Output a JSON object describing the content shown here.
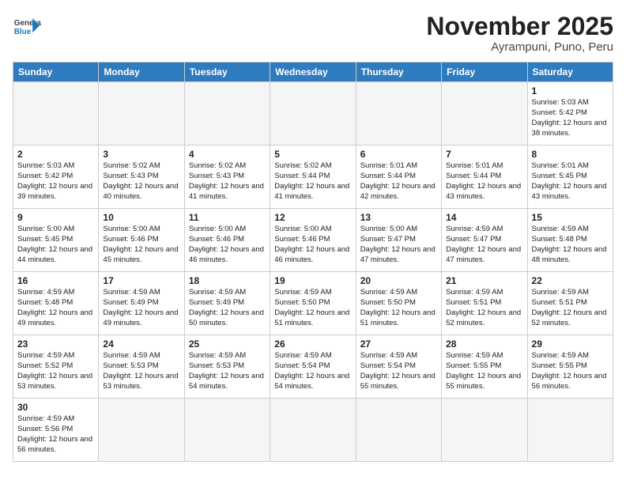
{
  "header": {
    "logo_general": "General",
    "logo_blue": "Blue",
    "month_title": "November 2025",
    "location": "Ayrampuni, Puno, Peru"
  },
  "weekdays": [
    "Sunday",
    "Monday",
    "Tuesday",
    "Wednesday",
    "Thursday",
    "Friday",
    "Saturday"
  ],
  "cells": [
    [
      {
        "day": "",
        "info": ""
      },
      {
        "day": "",
        "info": ""
      },
      {
        "day": "",
        "info": ""
      },
      {
        "day": "",
        "info": ""
      },
      {
        "day": "",
        "info": ""
      },
      {
        "day": "",
        "info": ""
      },
      {
        "day": "1",
        "info": "Sunrise: 5:03 AM\nSunset: 5:42 PM\nDaylight: 12 hours and 38 minutes."
      }
    ],
    [
      {
        "day": "2",
        "info": "Sunrise: 5:03 AM\nSunset: 5:42 PM\nDaylight: 12 hours and 39 minutes."
      },
      {
        "day": "3",
        "info": "Sunrise: 5:02 AM\nSunset: 5:43 PM\nDaylight: 12 hours and 40 minutes."
      },
      {
        "day": "4",
        "info": "Sunrise: 5:02 AM\nSunset: 5:43 PM\nDaylight: 12 hours and 41 minutes."
      },
      {
        "day": "5",
        "info": "Sunrise: 5:02 AM\nSunset: 5:44 PM\nDaylight: 12 hours and 41 minutes."
      },
      {
        "day": "6",
        "info": "Sunrise: 5:01 AM\nSunset: 5:44 PM\nDaylight: 12 hours and 42 minutes."
      },
      {
        "day": "7",
        "info": "Sunrise: 5:01 AM\nSunset: 5:44 PM\nDaylight: 12 hours and 43 minutes."
      },
      {
        "day": "8",
        "info": "Sunrise: 5:01 AM\nSunset: 5:45 PM\nDaylight: 12 hours and 43 minutes."
      }
    ],
    [
      {
        "day": "9",
        "info": "Sunrise: 5:00 AM\nSunset: 5:45 PM\nDaylight: 12 hours and 44 minutes."
      },
      {
        "day": "10",
        "info": "Sunrise: 5:00 AM\nSunset: 5:46 PM\nDaylight: 12 hours and 45 minutes."
      },
      {
        "day": "11",
        "info": "Sunrise: 5:00 AM\nSunset: 5:46 PM\nDaylight: 12 hours and 46 minutes."
      },
      {
        "day": "12",
        "info": "Sunrise: 5:00 AM\nSunset: 5:46 PM\nDaylight: 12 hours and 46 minutes."
      },
      {
        "day": "13",
        "info": "Sunrise: 5:00 AM\nSunset: 5:47 PM\nDaylight: 12 hours and 47 minutes."
      },
      {
        "day": "14",
        "info": "Sunrise: 4:59 AM\nSunset: 5:47 PM\nDaylight: 12 hours and 47 minutes."
      },
      {
        "day": "15",
        "info": "Sunrise: 4:59 AM\nSunset: 5:48 PM\nDaylight: 12 hours and 48 minutes."
      }
    ],
    [
      {
        "day": "16",
        "info": "Sunrise: 4:59 AM\nSunset: 5:48 PM\nDaylight: 12 hours and 49 minutes."
      },
      {
        "day": "17",
        "info": "Sunrise: 4:59 AM\nSunset: 5:49 PM\nDaylight: 12 hours and 49 minutes."
      },
      {
        "day": "18",
        "info": "Sunrise: 4:59 AM\nSunset: 5:49 PM\nDaylight: 12 hours and 50 minutes."
      },
      {
        "day": "19",
        "info": "Sunrise: 4:59 AM\nSunset: 5:50 PM\nDaylight: 12 hours and 51 minutes."
      },
      {
        "day": "20",
        "info": "Sunrise: 4:59 AM\nSunset: 5:50 PM\nDaylight: 12 hours and 51 minutes."
      },
      {
        "day": "21",
        "info": "Sunrise: 4:59 AM\nSunset: 5:51 PM\nDaylight: 12 hours and 52 minutes."
      },
      {
        "day": "22",
        "info": "Sunrise: 4:59 AM\nSunset: 5:51 PM\nDaylight: 12 hours and 52 minutes."
      }
    ],
    [
      {
        "day": "23",
        "info": "Sunrise: 4:59 AM\nSunset: 5:52 PM\nDaylight: 12 hours and 53 minutes."
      },
      {
        "day": "24",
        "info": "Sunrise: 4:59 AM\nSunset: 5:53 PM\nDaylight: 12 hours and 53 minutes."
      },
      {
        "day": "25",
        "info": "Sunrise: 4:59 AM\nSunset: 5:53 PM\nDaylight: 12 hours and 54 minutes."
      },
      {
        "day": "26",
        "info": "Sunrise: 4:59 AM\nSunset: 5:54 PM\nDaylight: 12 hours and 54 minutes."
      },
      {
        "day": "27",
        "info": "Sunrise: 4:59 AM\nSunset: 5:54 PM\nDaylight: 12 hours and 55 minutes."
      },
      {
        "day": "28",
        "info": "Sunrise: 4:59 AM\nSunset: 5:55 PM\nDaylight: 12 hours and 55 minutes."
      },
      {
        "day": "29",
        "info": "Sunrise: 4:59 AM\nSunset: 5:55 PM\nDaylight: 12 hours and 56 minutes."
      }
    ],
    [
      {
        "day": "30",
        "info": "Sunrise: 4:59 AM\nSunset: 5:56 PM\nDaylight: 12 hours and 56 minutes."
      },
      {
        "day": "",
        "info": ""
      },
      {
        "day": "",
        "info": ""
      },
      {
        "day": "",
        "info": ""
      },
      {
        "day": "",
        "info": ""
      },
      {
        "day": "",
        "info": ""
      },
      {
        "day": "",
        "info": ""
      }
    ]
  ]
}
